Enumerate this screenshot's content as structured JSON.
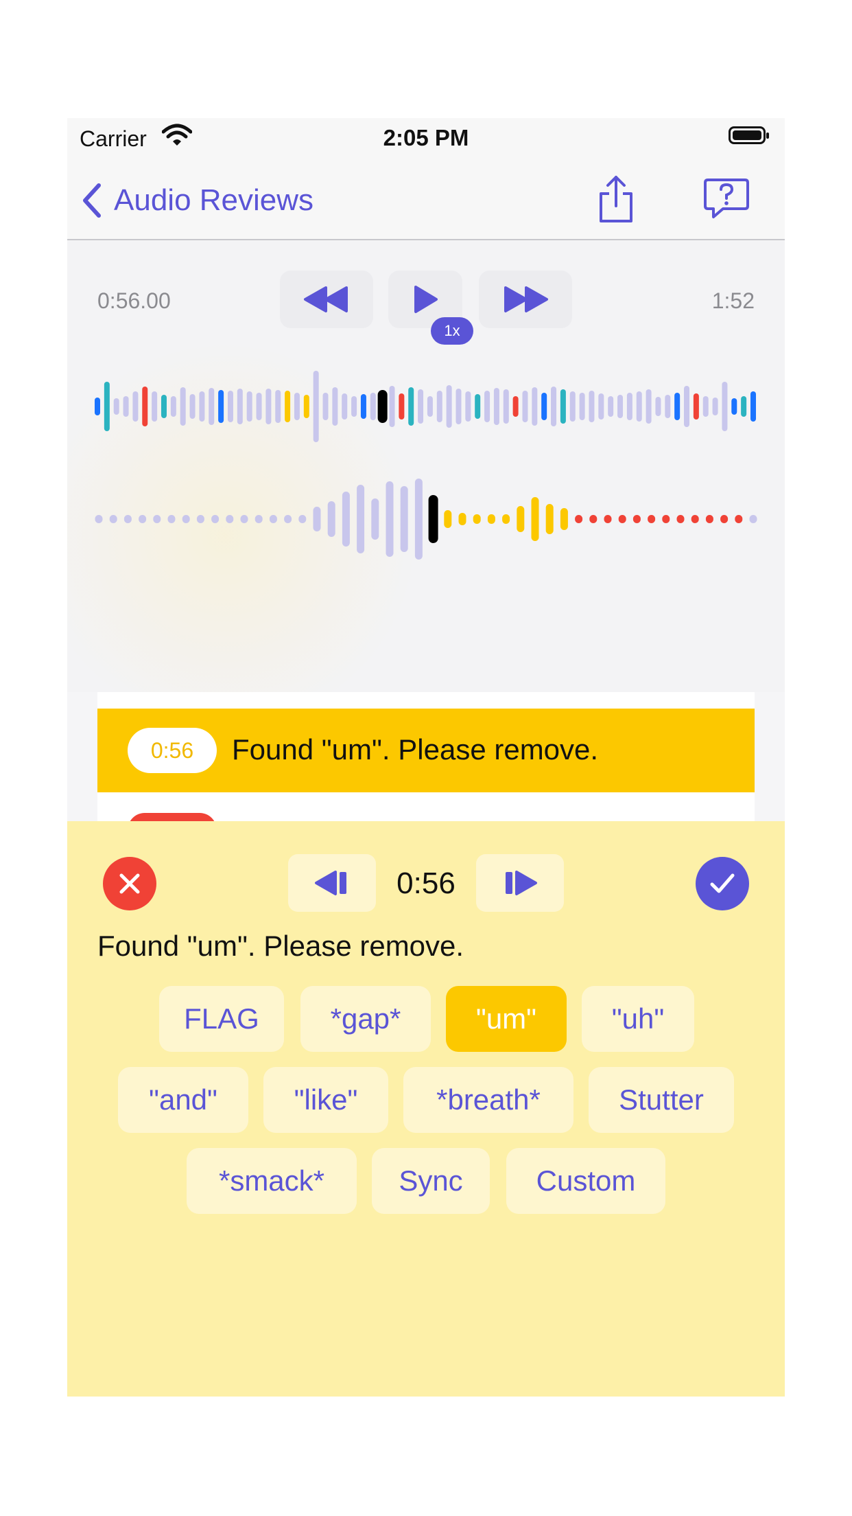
{
  "status_bar": {
    "carrier": "Carrier",
    "time": "2:05 PM"
  },
  "nav": {
    "back_label": "Audio Reviews",
    "share_icon": "share-icon",
    "help_icon": "help-bubble-icon"
  },
  "player": {
    "current_time": "0:56.00",
    "total_time": "1:52",
    "speed": "1x"
  },
  "flag_list": {
    "selected": {
      "time": "0:56",
      "text": "Found \"um\".  Please remove."
    }
  },
  "editor": {
    "time": "0:56",
    "text": "Found \"um\".  Please remove.",
    "tags": [
      {
        "label": "FLAG",
        "selected": false
      },
      {
        "label": "*gap*",
        "selected": false
      },
      {
        "label": "\"um\"",
        "selected": true
      },
      {
        "label": "\"uh\"",
        "selected": false
      },
      {
        "label": "\"and\"",
        "selected": false
      },
      {
        "label": "\"like\"",
        "selected": false
      },
      {
        "label": "*breath*",
        "selected": false
      },
      {
        "label": "Stutter",
        "selected": false
      },
      {
        "label": "*smack*",
        "selected": false
      },
      {
        "label": "Sync",
        "selected": false
      },
      {
        "label": "Custom",
        "selected": false
      }
    ]
  },
  "colors": {
    "accent": "#5a54d6",
    "highlight": "#fcc800",
    "danger": "#f04236",
    "waveform_neutral": "#c8c6ec",
    "waveform_blue": "#1a73ff",
    "waveform_teal": "#2bb3c0",
    "waveform_black": "#000000",
    "panel_background": "#fdf0a8"
  }
}
